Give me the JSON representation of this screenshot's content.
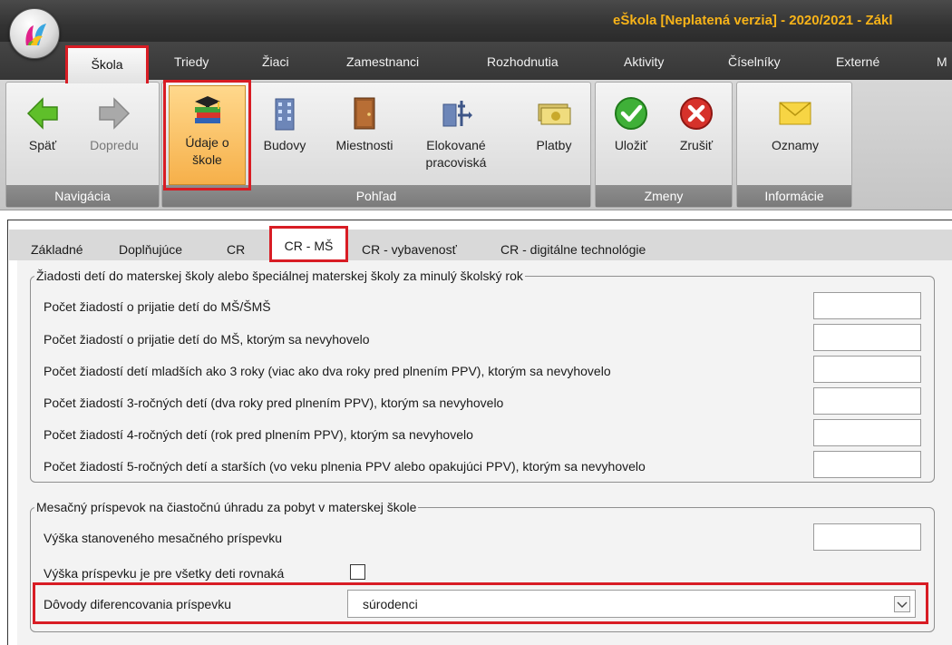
{
  "window": {
    "title": "eŠkola [Neplatená verzia] - 2020/2021 - Zákl"
  },
  "menu": {
    "tabs": [
      "Škola",
      "Triedy",
      "Žiaci",
      "Zamestnanci",
      "Rozhodnutia",
      "Aktivity",
      "Číselníky",
      "Externé",
      "M"
    ]
  },
  "ribbon": {
    "groups": {
      "nav": "Navigácia",
      "view": "Pohľad",
      "changes": "Zmeny",
      "info": "Informácie"
    },
    "buttons": {
      "back": "Späť",
      "forward": "Dopredu",
      "udaje_1": "Údaje o",
      "udaje_2": "škole",
      "budovy": "Budovy",
      "miestnosti": "Miestnosti",
      "elok_1": "Elokované",
      "elok_2": "pracoviská",
      "platby": "Platby",
      "ulozit": "Uložiť",
      "zrusit": "Zrušiť",
      "oznamy": "Oznamy"
    }
  },
  "subtabs": [
    "Základné",
    "Doplňujúce",
    "CR",
    "CR - MŠ",
    "CR - vybavenosť",
    "CR - digitálne technológie"
  ],
  "section1": {
    "legend": "Žiadosti detí do materskej školy alebo špeciálnej materskej školy za minulý školský rok",
    "rows": [
      {
        "label": "Počet žiadostí o prijatie detí do MŠ/ŠMŠ",
        "value": ""
      },
      {
        "label": "Počet žiadostí o prijatie detí do MŠ, ktorým sa nevyhovelo",
        "value": ""
      },
      {
        "label": "Počet žiadostí detí mladších ako 3 roky (viac ako dva roky pred plnením PPV), ktorým sa nevyhovelo",
        "value": ""
      },
      {
        "label": "Počet žiadostí 3-ročných detí (dva roky pred plnením PPV), ktorým sa nevyhovelo",
        "value": ""
      },
      {
        "label": "Počet žiadostí 4-ročných detí (rok pred plnením PPV), ktorým sa nevyhovelo",
        "value": ""
      },
      {
        "label": "Počet žiadostí 5-ročných detí a starších (vo veku plnenia PPV alebo opakujúci PPV), ktorým sa nevyhovelo",
        "value": ""
      }
    ]
  },
  "section2": {
    "legend": "Mesačný príspevok na čiastočnú úhradu za pobyt v materskej škole",
    "amount_label": "Výška stanoveného mesačného príspevku",
    "amount_value": "",
    "equal_label": "Výška príspevku je pre všetky deti rovnaká",
    "equal_checked": false,
    "reasons_label": "Dôvody diferencovania príspevku",
    "reasons_value": "súrodenci"
  },
  "colors": {
    "highlight": "#d81c24",
    "title": "#f7b319",
    "accent_orange": "#f6b04a"
  },
  "icons": [
    "app-logo-icon",
    "back-arrow-icon",
    "forward-arrow-icon",
    "school-books-icon",
    "building-icon",
    "door-icon",
    "elocated-icon",
    "money-icon",
    "save-check-icon",
    "cancel-x-icon",
    "envelope-icon",
    "chevron-down-icon"
  ]
}
